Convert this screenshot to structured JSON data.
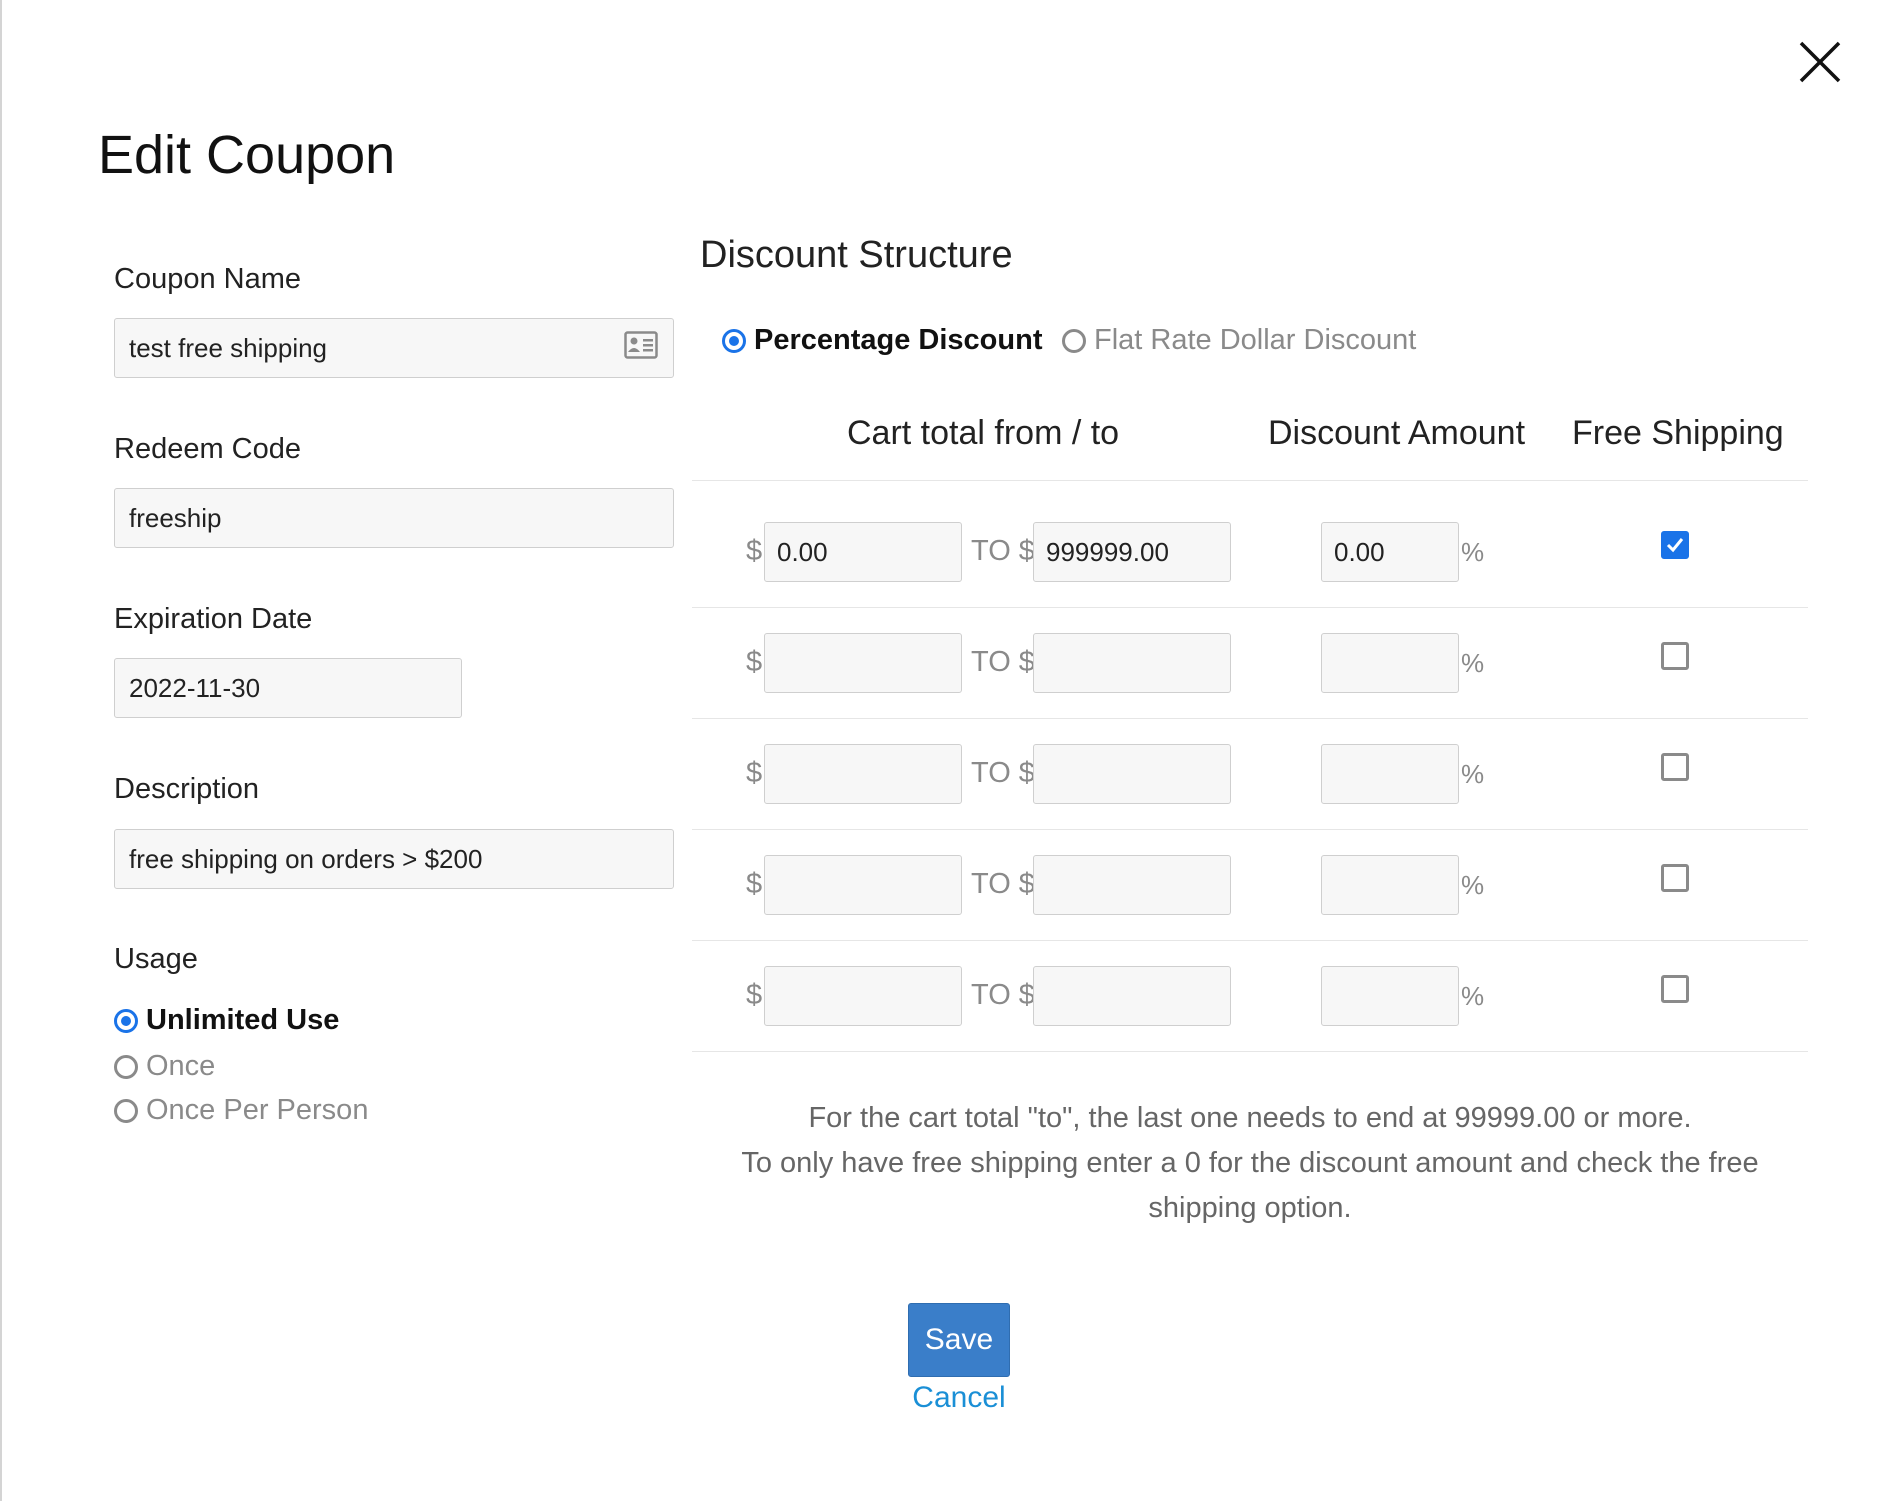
{
  "dialog": {
    "title": "Edit Coupon"
  },
  "form": {
    "coupon_name_label": "Coupon Name",
    "coupon_name_value": "test free shipping",
    "redeem_code_label": "Redeem Code",
    "redeem_code_value": "freeship",
    "expiration_label": "Expiration Date",
    "expiration_value": "2022-11-30",
    "description_label": "Description",
    "description_value": "free shipping on orders > $200",
    "usage_label": "Usage",
    "usage_options": [
      {
        "label": "Unlimited Use",
        "selected": true
      },
      {
        "label": "Once",
        "selected": false
      },
      {
        "label": "Once Per Person",
        "selected": false
      }
    ]
  },
  "discount": {
    "title": "Discount Structure",
    "types": [
      {
        "label": "Percentage Discount",
        "selected": true
      },
      {
        "label": "Flat Rate Dollar Discount",
        "selected": false
      }
    ],
    "headers": {
      "cart_total": "Cart total from / to",
      "amount": "Discount Amount",
      "free_shipping": "Free Shipping"
    },
    "currency_symbol": "$",
    "to_label": "TO $",
    "percent_symbol": "%",
    "tiers": [
      {
        "from": "0.00",
        "to": "999999.00",
        "amount": "0.00",
        "free_shipping": true
      },
      {
        "from": "",
        "to": "",
        "amount": "",
        "free_shipping": false
      },
      {
        "from": "",
        "to": "",
        "amount": "",
        "free_shipping": false
      },
      {
        "from": "",
        "to": "",
        "amount": "",
        "free_shipping": false
      },
      {
        "from": "",
        "to": "",
        "amount": "",
        "free_shipping": false
      }
    ],
    "note_line1": "For the cart total \"to\", the last one needs to end at 99999.00 or more.",
    "note_line2": "To only have free shipping enter a 0 for the discount amount and check the free shipping option."
  },
  "actions": {
    "save_label": "Save",
    "cancel_label": "Cancel"
  },
  "colors": {
    "accent": "#1a73e8",
    "save_button": "#3a7ec9",
    "cancel_link": "#1a8fd6"
  },
  "icons": {
    "close": "close-icon",
    "contact_card": "contact-card-icon",
    "checkmark": "checkmark-icon"
  }
}
